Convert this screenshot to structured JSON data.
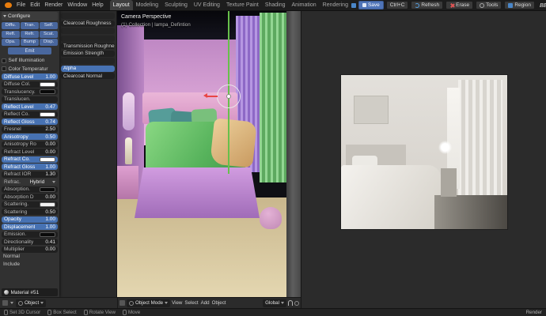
{
  "topbar": {
    "menus": [
      "File",
      "Edit",
      "Render",
      "Window",
      "Help"
    ],
    "tabs": [
      "Layout",
      "Modeling",
      "Sculpting",
      "UV Editing",
      "Texture Paint",
      "Shading",
      "Animation",
      "Rendering"
    ],
    "active_tab": "Layout",
    "actions": {
      "save": "Save",
      "copy": "Ctrl+C",
      "refresh": "Refresh",
      "erase": "Erase",
      "tools": "Tools",
      "region": "Region",
      "pass": "BEAUTY"
    }
  },
  "material_panel": {
    "header": "Configure",
    "map_buttons": [
      "Diffu.",
      "Tran.",
      "Self.",
      "Refl.",
      "Refr.",
      "Scat.",
      "Opa.",
      "Bump",
      "Disp."
    ],
    "emit_button": "Emit",
    "self_illumination": "Self Illumination",
    "color_temperature": "Color Temperatur",
    "params": [
      {
        "label": "Diffuse Level",
        "value": "1.00",
        "kind": "value",
        "hl": true
      },
      {
        "label": "Diffuse Col.",
        "kind": "color",
        "swatch": "#ffffff"
      },
      {
        "label": "Translucency.",
        "kind": "color",
        "swatch": "#0a0a0a"
      },
      {
        "label": "Translucen.",
        "value": "",
        "kind": "value"
      },
      {
        "label": "Reflect Level",
        "value": "0.47",
        "kind": "value",
        "hl": true
      },
      {
        "label": "Reflect Co.",
        "kind": "color",
        "swatch": "#ffffff"
      },
      {
        "label": "Reflect Gloss",
        "value": "0.74",
        "kind": "value",
        "hl": true
      },
      {
        "label": "Fresnel",
        "value": "2.50",
        "kind": "value"
      },
      {
        "label": "Anisotropy",
        "value": "0.50",
        "kind": "value",
        "hl": true
      },
      {
        "label": "Anisotropy Ro",
        "value": "0.00",
        "kind": "value"
      },
      {
        "label": "Refract Level",
        "value": "0.00",
        "kind": "value"
      },
      {
        "label": "Refract Co.",
        "kind": "color",
        "swatch": "#ffffff",
        "hl": true
      },
      {
        "label": "Refract Gloss",
        "value": "1.00",
        "kind": "value",
        "hl": true
      },
      {
        "label": "Refract IOR",
        "value": "1.30",
        "kind": "value"
      },
      {
        "label": "Refrac.",
        "value": "Hybrid",
        "kind": "dropdown"
      },
      {
        "label": "Absorption.",
        "kind": "color",
        "swatch": "#0a0a0a"
      },
      {
        "label": "Absorption D",
        "value": "0.00",
        "kind": "value"
      },
      {
        "label": "Scattering.",
        "kind": "color",
        "swatch": "#f2f2f2"
      },
      {
        "label": "Scattering",
        "value": "0.50",
        "kind": "value"
      },
      {
        "label": "Opacity",
        "value": "1.00",
        "kind": "value",
        "hl": true
      },
      {
        "label": "Displacement",
        "value": "1.00",
        "kind": "value",
        "hl": true
      },
      {
        "label": "Emission.",
        "kind": "color",
        "swatch": "#0a0a0a"
      },
      {
        "label": "Directionality",
        "value": "0.41",
        "kind": "value"
      },
      {
        "label": "Multiplier",
        "value": "0.00",
        "kind": "value"
      },
      {
        "label": "Normal",
        "kind": "section"
      },
      {
        "label": "Include",
        "kind": "section"
      }
    ],
    "material_name": "Material #51"
  },
  "shader_panel": {
    "rows": [
      "",
      "Clearcoat Roughness",
      "",
      "",
      "Transmission Roughness",
      "Emission Strength",
      "",
      "Alpha",
      "Clearcoat Normal"
    ],
    "highlight": "Alpha"
  },
  "viewport": {
    "view_label": "Camera Perspective",
    "collection_label": "(1) Collection | lampa_Defintion",
    "footer": {
      "mode": "Object Mode",
      "menus": [
        "View",
        "Select",
        "Add",
        "Object"
      ],
      "orientation": "Global"
    }
  },
  "left_footer": {
    "mode": "Object"
  },
  "statusbar": {
    "items": [
      "Set 3D Cursor",
      "Box Select",
      "Rotate View",
      "Move"
    ],
    "right": "Render"
  },
  "colors": {
    "accent": "#4772b3",
    "save_button": "#4f74b8",
    "erase_icon": "#e05555",
    "refresh_icon": "#57a0e0",
    "logo_orange": "#e87d0d"
  }
}
